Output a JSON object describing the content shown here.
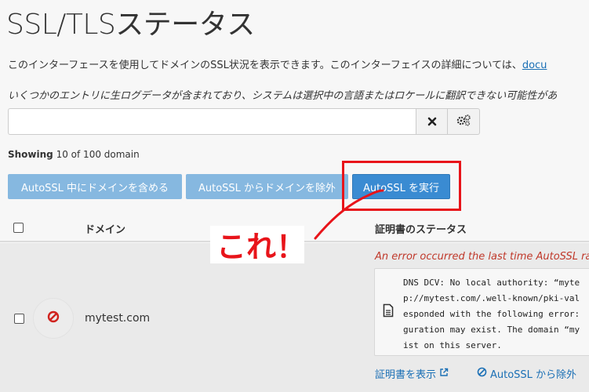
{
  "page": {
    "title": "SSL/TLSステータス",
    "description": "このインターフェースを使用してドメインのSSL状況を表示できます。このインターフェイスの詳細については、",
    "description_link": "docu",
    "note": "いくつかのエントリに生ログデータが含まれており、システムは選択中の言語またはロケールに翻訳できない可能性があ"
  },
  "search": {
    "value": "",
    "placeholder": ""
  },
  "toolbar": {
    "clear_icon": "close-icon",
    "settings_icon": "gears-icon"
  },
  "showing": {
    "label": "Showing",
    "text": "10 of 100 domain"
  },
  "buttons": {
    "include": "AutoSSL 中にドメインを含める",
    "exclude": "AutoSSL からドメインを除外",
    "run": "AutoSSL を実行"
  },
  "annotation": {
    "text": "これ！",
    "color": "#e8141a"
  },
  "table": {
    "headers": {
      "domain": "ドメイン",
      "status": "証明書のステータス"
    },
    "rows": [
      {
        "domain": "mytest.com",
        "status_icon": "no-entry-icon",
        "error": "An error occurred the last time AutoSSL ran,",
        "dns_lines": [
          "DNS DCV: No local authority: “myte",
          "p://mytest.com/.well-known/pki-val",
          "esponded with the following error:",
          "guration may exist. The domain “my",
          "ist on this server."
        ],
        "view_cert": "証明書を表示",
        "exclude_link": "AutoSSL から除外"
      }
    ]
  },
  "colors": {
    "accent": "#3a8bd2",
    "light_button": "#86b8e0",
    "error": "#c0392b",
    "link": "#1a6fb5"
  }
}
